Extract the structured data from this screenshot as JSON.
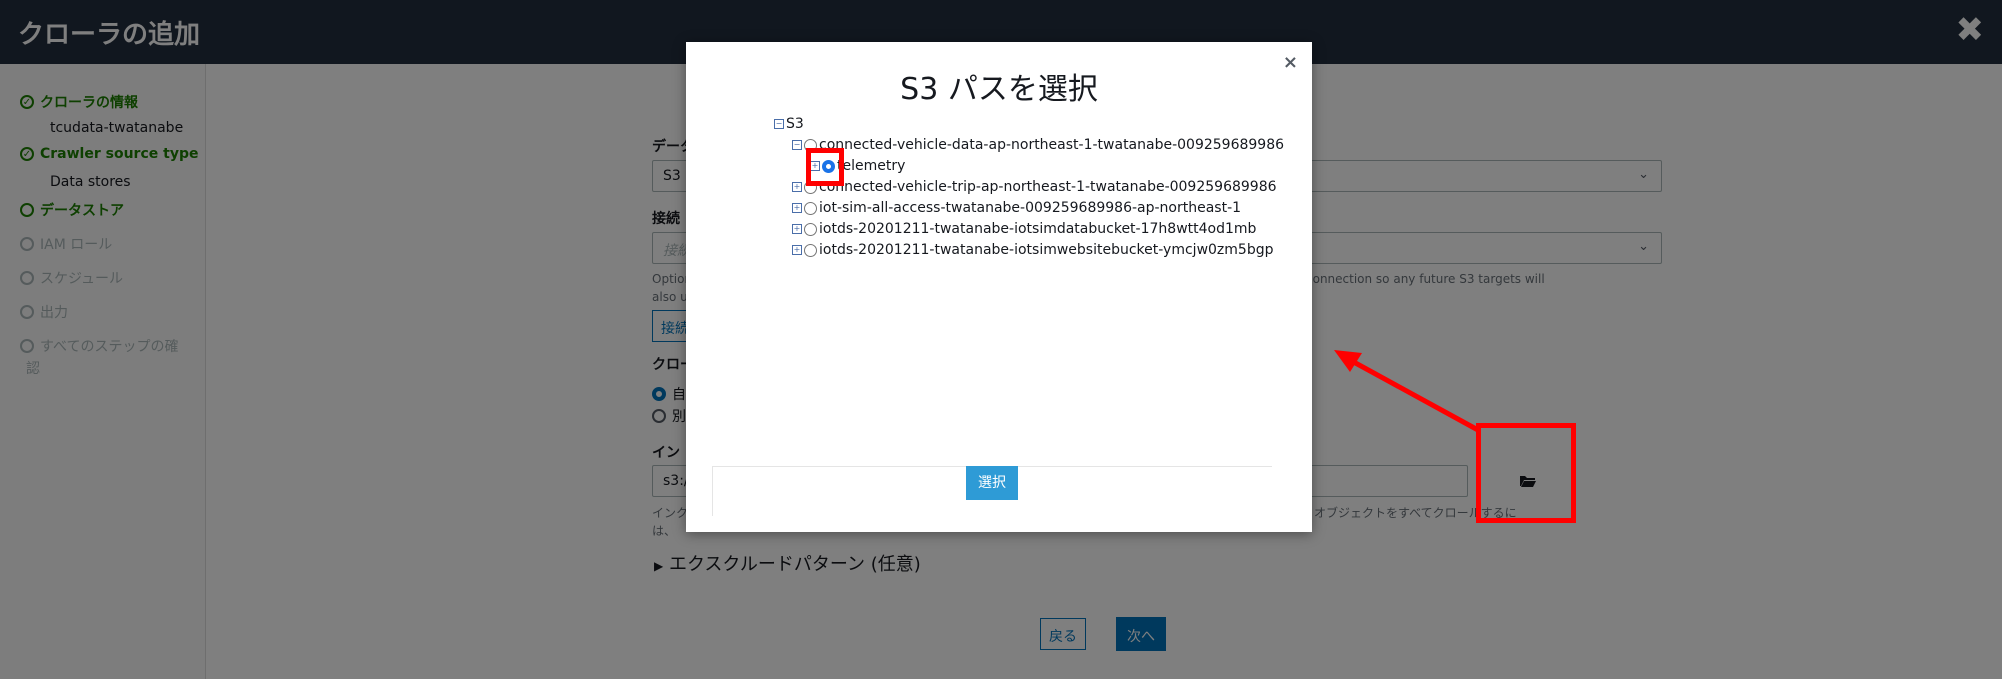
{
  "header": {
    "title": "クローラの追加",
    "close_symbol": "✖"
  },
  "sidebar": {
    "steps": [
      {
        "label": "クローラの情報",
        "sub": "tcudata-twatanabe",
        "state": "done"
      },
      {
        "label": "Crawler source type",
        "sub": "Data stores",
        "state": "done"
      },
      {
        "label": "データストア",
        "state": "active"
      },
      {
        "label": "IAM ロール",
        "state": "inactive"
      },
      {
        "label": "スケジュール",
        "state": "inactive"
      },
      {
        "label": "出力",
        "state": "inactive"
      },
      {
        "label": "すべてのステップの確",
        "label2": "認",
        "state": "inactive"
      }
    ]
  },
  "form": {
    "datastore_label": "データ",
    "datastore_value": "S3",
    "connection_label": "接続",
    "connection_placeholder": "接続",
    "help_optional": "Option",
    "help_optional_right": "connection so any future S3 targets will",
    "help_also": "also u",
    "add_connection_btn": "接続",
    "crawl_label": "クロー",
    "radio_1": "自",
    "radio_2": "別",
    "include_label": "イン",
    "include_value": "s3:/",
    "include_help_left": "インク",
    "include_help_right": "オブジェクトをすべてクロールするに",
    "include_help_line2": "は、",
    "exclude_pattern": "エクスクルードパターン (任意)",
    "back_btn": "戻る",
    "next_btn": "次へ"
  },
  "modal": {
    "title": "S3 パスを選択",
    "close": "×",
    "tree": {
      "root": "S3",
      "buckets": [
        {
          "name": "connected-vehicle-data-ap-northeast-1-twatanabe-009259689986",
          "expanded": true,
          "children": [
            "telemetry"
          ]
        },
        {
          "name": "connected-vehicle-trip-ap-northeast-1-twatanabe-009259689986",
          "expanded": false
        },
        {
          "name": "iot-sim-all-access-twatanabe-009259689986-ap-northeast-1",
          "expanded": false
        },
        {
          "name": "iotds-20201211-twatanabe-iotsimdatabucket-17h8wtt4od1mb",
          "expanded": false
        },
        {
          "name": "iotds-20201211-twatanabe-iotsimwebsitebucket-ymcjw0zm5bgp",
          "expanded": false
        }
      ]
    },
    "select_btn": "選択"
  },
  "colors": {
    "header_bg": "#232f3e",
    "success": "#1d8102",
    "primary": "#0073bb",
    "annotation": "#ff0000"
  }
}
